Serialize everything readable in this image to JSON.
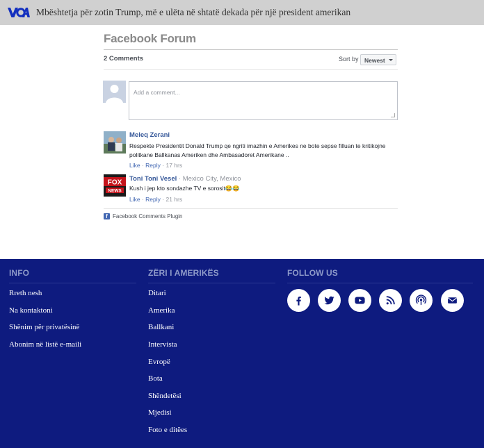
{
  "header": {
    "headline": "Mbështetja për zotin Trump, më e ulëta në shtatë dekada për një president amerikan"
  },
  "forum": {
    "title": "Facebook Forum",
    "comment_count": "2 Comments",
    "sort_label": "Sort by",
    "sort_value": "Newest",
    "comment_placeholder": "Add a comment...",
    "plugin_label": "Facebook Comments Plugin"
  },
  "comments": [
    {
      "author": "Meleq Zerani",
      "location": "",
      "text": "Respekte Presidentit Donald Trump qe ngriti imazhin e Amerikes ne bote sepse filluan te kritikojne politkane Ballkanas Ameriken dhe Ambasadoret Amerikane ..",
      "like": "Like",
      "reply": "Reply",
      "time": "17 hrs"
    },
    {
      "author": "Toni Toni Vesel",
      "location": "Mexico City, Mexico",
      "text": "Kush i jep kto sondazhe TV e sorosit😂😂",
      "like": "Like",
      "reply": "Reply",
      "time": "21 hrs",
      "avatar_text": "FOX NEWS"
    }
  ],
  "footer": {
    "col1": {
      "heading": "INFO",
      "links": [
        "Rreth nesh",
        "Na kontaktoni",
        "Shënim për privatësinë",
        "Abonim në listë e-maili"
      ]
    },
    "col2": {
      "heading": "ZËRI I AMERIKËS",
      "links": [
        "Ditari",
        "Amerika",
        "Ballkani",
        "Intervista",
        "Evropë",
        "Bota",
        "Shëndetësi",
        "Mjedisi",
        "Foto e ditëes"
      ]
    },
    "col3": {
      "heading": "FOLLOW US",
      "icons": [
        "facebook-icon",
        "twitter-icon",
        "youtube-icon",
        "rss-icon",
        "podcast-icon",
        "email-icon"
      ]
    }
  },
  "colors": {
    "footer_bg": "#0e1b7f",
    "topbar_bg": "#d0d0d0",
    "fb_link": "#365899",
    "logo_blue": "#1330bf"
  }
}
